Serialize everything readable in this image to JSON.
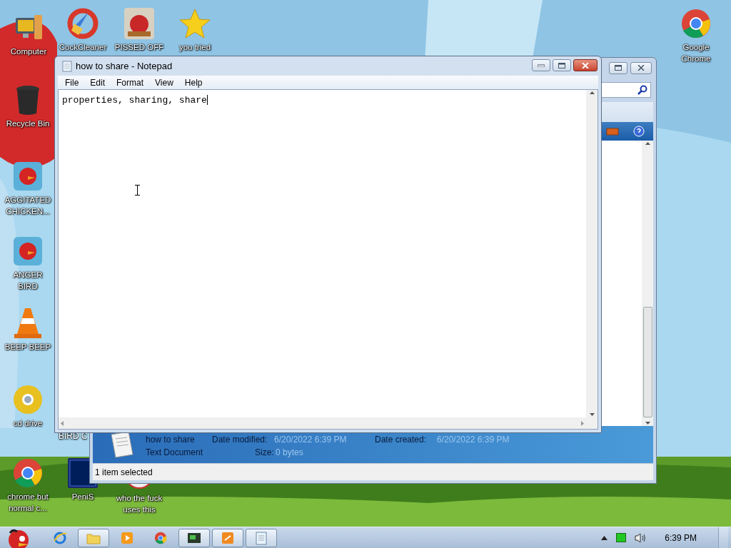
{
  "desktop_icons": [
    {
      "label": "Computer",
      "kind": "computer"
    },
    {
      "label": "CockCleaner",
      "kind": "cleaner"
    },
    {
      "label": "PISSED OFF",
      "kind": "game"
    },
    {
      "label": "you tried",
      "kind": "star"
    },
    {
      "label": "Google Chrome",
      "kind": "chrome"
    },
    {
      "label": "Recycle Bin",
      "kind": "bin"
    },
    {
      "label": "AGGITATED CHICKEN...",
      "kind": "bird"
    },
    {
      "label": "ANGER BIRD",
      "kind": "bird"
    },
    {
      "label": "BEEP BEEP",
      "kind": "cone"
    },
    {
      "label": "cd drive",
      "kind": "disc"
    },
    {
      "label": "chrome but normal c...",
      "kind": "chrome"
    },
    {
      "label": "PeniS",
      "kind": "ps"
    },
    {
      "label": "who the fuck uses this",
      "kind": "round"
    },
    {
      "label": "BIRD C",
      "kind": "cut"
    }
  ],
  "explorer": {
    "details": {
      "name": "how to share",
      "modified_label": "Date modified:",
      "modified": "6/20/2022 6:39 PM",
      "created_label": "Date created:",
      "created": "6/20/2022 6:39 PM",
      "type": "Text Document",
      "size_label": "Size:",
      "size": "0 bytes"
    },
    "status": "1 item selected"
  },
  "notepad": {
    "title": "how to share - Notepad",
    "menu": [
      "File",
      "Edit",
      "Format",
      "View",
      "Help"
    ],
    "text": "properties, sharing, share"
  },
  "taskbar": {
    "items": [
      {
        "kind": "ie",
        "running": false
      },
      {
        "kind": "folder",
        "running": true
      },
      {
        "kind": "media",
        "running": false
      },
      {
        "kind": "chrome",
        "running": false
      },
      {
        "kind": "terminal",
        "running": true
      },
      {
        "kind": "editor",
        "running": true
      },
      {
        "kind": "notepad",
        "running": true
      }
    ],
    "clock": "6:39 PM"
  }
}
